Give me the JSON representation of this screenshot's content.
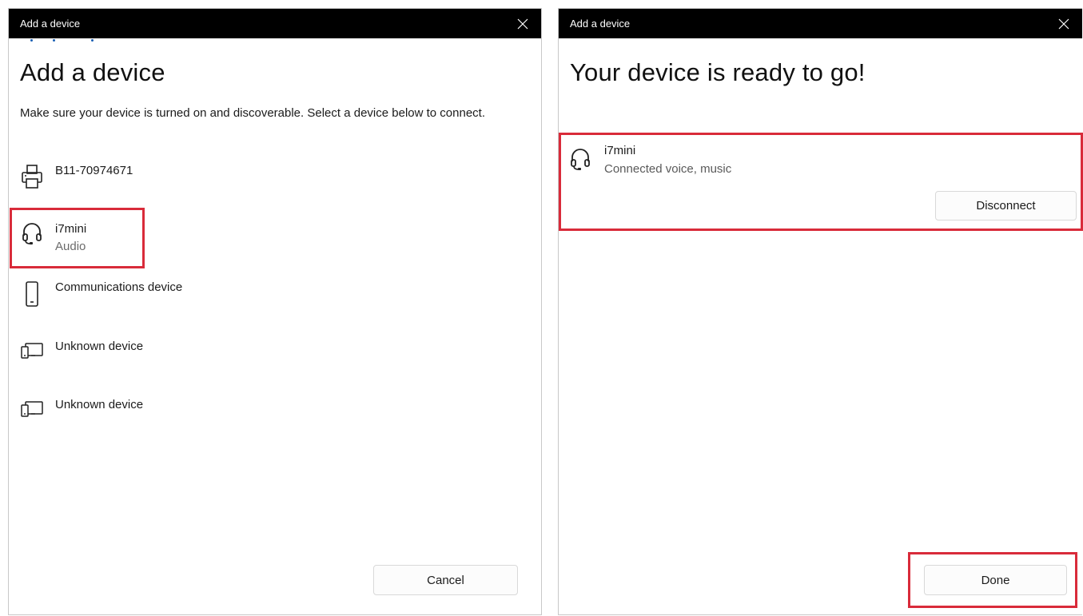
{
  "left_dialog": {
    "window_title": "Add a device",
    "heading": "Add a device",
    "description": "Make sure your device is turned on and discoverable. Select a device below to connect.",
    "devices": [
      {
        "name": "B11-70974671",
        "sub": "",
        "icon": "printer-icon"
      },
      {
        "name": "i7mini",
        "sub": "Audio",
        "icon": "headphones-icon"
      },
      {
        "name": "Communications device",
        "sub": "",
        "icon": "phone-icon"
      },
      {
        "name": "Unknown device",
        "sub": "",
        "icon": "devices-icon"
      },
      {
        "name": "Unknown device",
        "sub": "",
        "icon": "devices-icon"
      }
    ],
    "cancel_label": "Cancel"
  },
  "right_dialog": {
    "window_title": "Add a device",
    "heading": "Your device is ready to go!",
    "connected_device": {
      "name": "i7mini",
      "status": "Connected voice, music",
      "icon": "headphones-icon",
      "disconnect_label": "Disconnect"
    },
    "done_label": "Done"
  },
  "colors": {
    "titlebar": "#000000",
    "highlight": "#d92b3a",
    "accent": "#1a5fb4"
  }
}
